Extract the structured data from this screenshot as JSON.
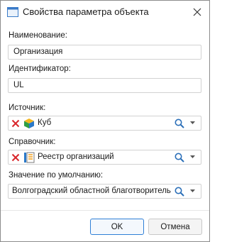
{
  "dialog": {
    "title": "Свойства параметра объекта"
  },
  "fields": {
    "name": {
      "label": "Наименование:",
      "value": "Организация"
    },
    "identifier": {
      "label": "Идентификатор:",
      "value": "UL"
    },
    "source": {
      "label": "Источник:",
      "value": "Куб",
      "icon": "cube-icon"
    },
    "dictionary": {
      "label": "Справочник:",
      "value": "Реестр организаций",
      "icon": "dictionary-icon"
    },
    "default": {
      "label": "Значение по умолчанию:",
      "value": "Волгоградский областной благотворительн"
    }
  },
  "buttons": {
    "ok": "OK",
    "cancel": "Отмена"
  },
  "colors": {
    "accent": "#2f7fd6",
    "clear_red": "#d9262b",
    "lookup_blue": "#2b6fb8"
  }
}
